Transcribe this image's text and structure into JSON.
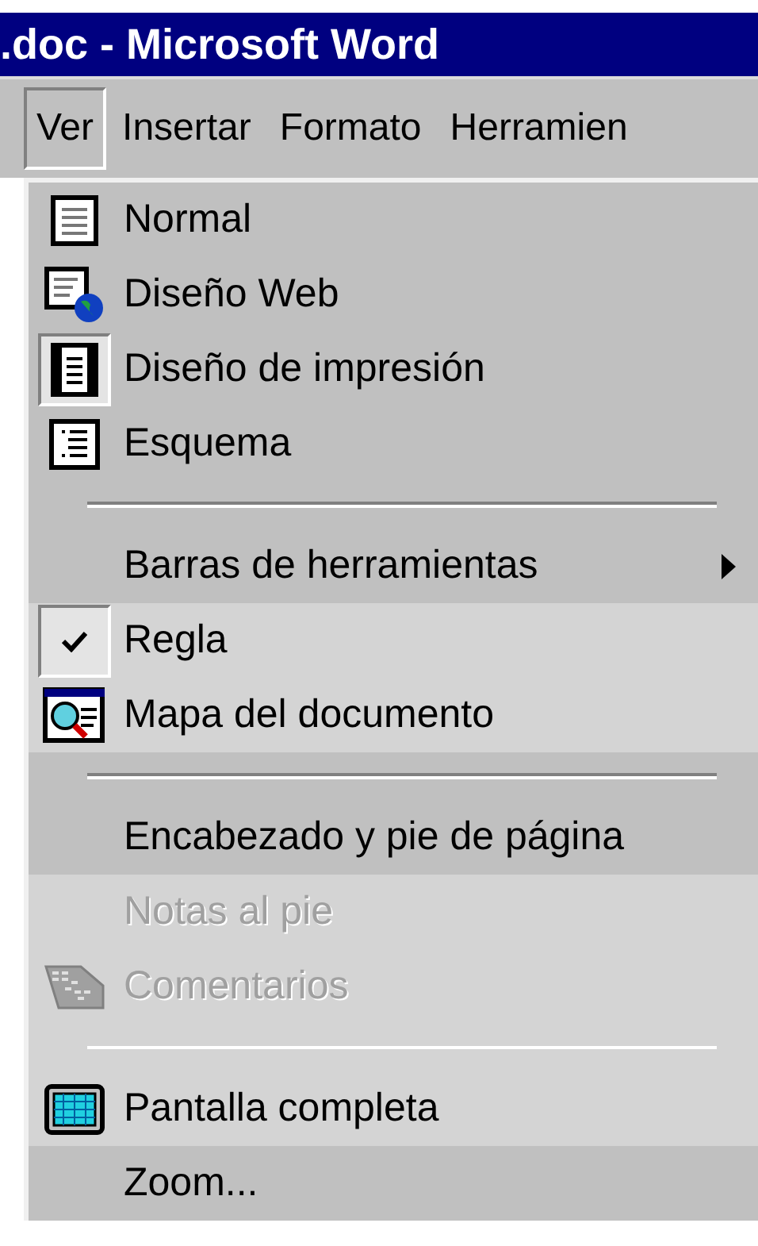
{
  "window": {
    "title": ".doc - Microsoft Word"
  },
  "menu_bar": [
    {
      "label": "Ver",
      "selected": true
    },
    {
      "label": "Insertar",
      "selected": false
    },
    {
      "label": "Formato",
      "selected": false
    },
    {
      "label": "Herramien",
      "selected": false
    }
  ],
  "menu": [
    {
      "kind": "command",
      "label": "Normal",
      "checked": false,
      "disabled": false,
      "recent": false
    },
    {
      "kind": "command",
      "label": "Diseño Web",
      "checked": false,
      "disabled": false,
      "recent": false
    },
    {
      "kind": "command",
      "label": "Diseño de impresión",
      "checked": true,
      "disabled": false,
      "recent": false
    },
    {
      "kind": "command",
      "label": "Esquema",
      "checked": false,
      "disabled": false,
      "recent": false
    },
    {
      "kind": "separator",
      "recent": false
    },
    {
      "kind": "submenu",
      "label": "Barras de herramientas",
      "checked": false,
      "disabled": false,
      "recent": false
    },
    {
      "kind": "command",
      "label": "Regla",
      "checked": true,
      "disabled": false,
      "recent": true
    },
    {
      "kind": "command",
      "label": "Mapa del documento",
      "checked": false,
      "disabled": false,
      "recent": true
    },
    {
      "kind": "separator",
      "recent": false
    },
    {
      "kind": "command",
      "label": "Encabezado y pie de página",
      "checked": false,
      "disabled": false,
      "recent": false
    },
    {
      "kind": "command",
      "label": "Notas al pie",
      "checked": false,
      "disabled": true,
      "recent": true
    },
    {
      "kind": "command",
      "label": "Comentarios",
      "checked": false,
      "disabled": true,
      "recent": true
    },
    {
      "kind": "separator",
      "recent": true
    },
    {
      "kind": "command",
      "label": "Pantalla completa",
      "checked": false,
      "disabled": false,
      "recent": true
    },
    {
      "kind": "command",
      "label": "Zoom...",
      "checked": false,
      "disabled": false,
      "recent": false
    }
  ]
}
